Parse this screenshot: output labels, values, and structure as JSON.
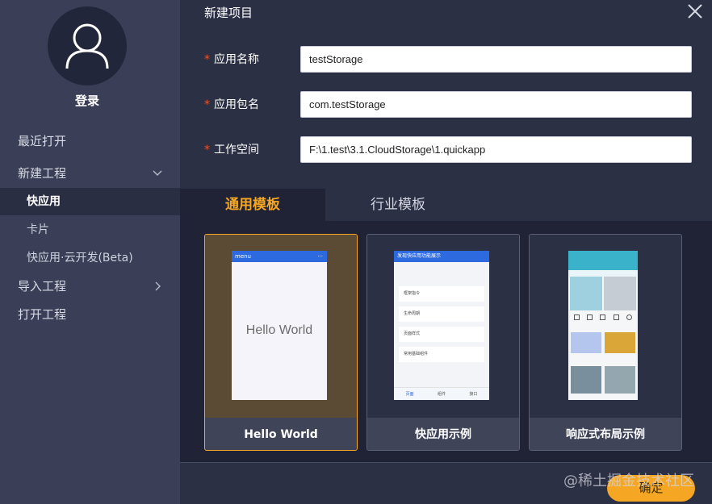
{
  "sidebar": {
    "login_label": "登录",
    "items": [
      {
        "label": "最近打开"
      },
      {
        "label": "新建工程"
      },
      {
        "label": "快应用"
      },
      {
        "label": "卡片"
      },
      {
        "label": "快应用·云开发(Beta)"
      },
      {
        "label": "导入工程"
      },
      {
        "label": "打开工程"
      }
    ]
  },
  "dialog": {
    "title": "新建项目",
    "required_mark": "*",
    "fields": [
      {
        "label": "应用名称",
        "value": "testStorage"
      },
      {
        "label": "应用包名",
        "value": "com.testStorage"
      },
      {
        "label": "工作空间",
        "value": "F:\\1.test\\3.1.CloudStorage\\1.quickapp"
      }
    ],
    "tabs": [
      {
        "label": "通用模板"
      },
      {
        "label": "行业模板"
      }
    ],
    "templates": [
      {
        "caption": "Hello World",
        "preview": {
          "header": "menu",
          "menu_dots": "···",
          "text": "Hello World"
        }
      },
      {
        "caption": "快应用示例",
        "preview": {
          "header": "发现快应用功能展示",
          "rows": [
            "框架指令",
            "生命周期",
            "页面样式",
            "常用基础组件"
          ],
          "footer": [
            "页面",
            "组件",
            "接口"
          ]
        }
      },
      {
        "caption": "响应式布局示例"
      }
    ],
    "confirm_label": "确定"
  },
  "watermark": "@稀土掘金技术社区",
  "colors": {
    "accent": "#f5a623",
    "sidebar_bg": "#3a3e56",
    "main_bg": "#2c3045",
    "panel_bg": "#1f2335",
    "required": "#e8562e"
  },
  "icons": {
    "avatar": "user-icon",
    "close": "close-icon",
    "expand": "chevron-down-icon",
    "collapse": "chevron-right-icon"
  }
}
